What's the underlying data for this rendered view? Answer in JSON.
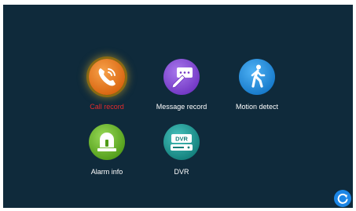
{
  "menu": {
    "items": [
      {
        "label": "Call record",
        "icon": "phone-icon",
        "selected": true,
        "color": "#e8781c"
      },
      {
        "label": "Message record",
        "icon": "message-edit-icon",
        "selected": false,
        "color": "#8d4fd6"
      },
      {
        "label": "Motion detect",
        "icon": "walking-person-icon",
        "selected": false,
        "color": "#1a8fe0"
      },
      {
        "label": "Alarm info",
        "icon": "alarm-bell-icon",
        "selected": false,
        "color": "#6cbd2a"
      },
      {
        "label": "DVR",
        "icon": "dvr-icon",
        "selected": false,
        "color": "#1fa19c",
        "badge": "DVR"
      }
    ]
  },
  "back_button": {
    "icon": "refresh-icon",
    "color": "#1c86e6"
  },
  "colors": {
    "background": "#0f2a3b",
    "selected_label": "#e32b2b",
    "label": "#ffffff"
  }
}
